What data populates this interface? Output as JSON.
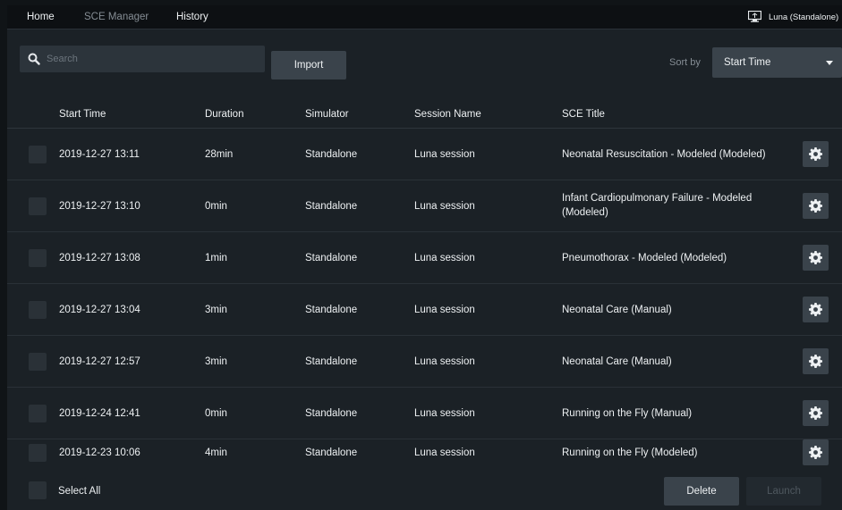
{
  "nav": {
    "tabs": [
      {
        "label": "Home"
      },
      {
        "label": "SCE Manager"
      },
      {
        "label": "History"
      }
    ],
    "user": "Luna (Standalone)",
    "display_icon": "monitor-icon"
  },
  "toolbar": {
    "search_placeholder": "Search",
    "import_label": "Import",
    "sort_label": "Sort by",
    "sort_value": "Start Time"
  },
  "table": {
    "columns": [
      "Start Time",
      "Duration",
      "Simulator",
      "Session Name",
      "SCE Title"
    ],
    "rows": [
      {
        "start": "2019-12-27 13:11",
        "duration": "28min",
        "simulator": "Standalone",
        "session": "Luna session",
        "title": "Neonatal Resuscitation - Modeled (Modeled)"
      },
      {
        "start": "2019-12-27 13:10",
        "duration": "0min",
        "simulator": "Standalone",
        "session": "Luna session",
        "title": "Infant Cardiopulmonary Failure - Modeled (Modeled)"
      },
      {
        "start": "2019-12-27 13:08",
        "duration": "1min",
        "simulator": "Standalone",
        "session": "Luna session",
        "title": "Pneumothorax - Modeled (Modeled)"
      },
      {
        "start": "2019-12-27 13:04",
        "duration": "3min",
        "simulator": "Standalone",
        "session": "Luna session",
        "title": "Neonatal Care (Manual)"
      },
      {
        "start": "2019-12-27 12:57",
        "duration": "3min",
        "simulator": "Standalone",
        "session": "Luna session",
        "title": "Neonatal Care (Manual)"
      },
      {
        "start": "2019-12-24 12:41",
        "duration": "0min",
        "simulator": "Standalone",
        "session": "Luna session",
        "title": "Running on the Fly (Manual)"
      },
      {
        "start": "2019-12-23 10:06",
        "duration": "4min",
        "simulator": "Standalone",
        "session": "Luna session",
        "title": "Running on the Fly (Modeled)"
      }
    ]
  },
  "footer": {
    "select_all_label": "Select All",
    "delete_label": "Delete",
    "disabled_label": "Launch"
  },
  "colors": {
    "background": "#1b2126",
    "topbar": "#0d1013",
    "button": "#3a434b",
    "text": "#eef1f3"
  }
}
